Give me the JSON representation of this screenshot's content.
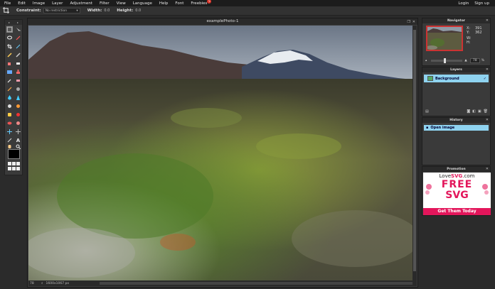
{
  "menu": {
    "items": [
      "File",
      "Edit",
      "Image",
      "Layer",
      "Adjustment",
      "Filter",
      "View",
      "Language",
      "Help",
      "Font",
      "Freebies"
    ],
    "freebies_badge": "5",
    "right": [
      "Login",
      "Sign up"
    ]
  },
  "options": {
    "constraint_label": "Constraint:",
    "constraint_value": "No restriction",
    "width_label": "Width:",
    "width_value": "0.0",
    "height_label": "Height:",
    "height_value": "0.0"
  },
  "canvas": {
    "title": "examplePhoto-1",
    "status_zoom": "78",
    "status_size": "1600x1067 px"
  },
  "navigator": {
    "title": "Navigator",
    "x_label": "X:",
    "x_value": "391",
    "y_label": "Y:",
    "y_value": "362",
    "w_label": "W:",
    "h_label": "H:",
    "zoom_value": "78",
    "zoom_unit": "%"
  },
  "layers": {
    "title": "Layers",
    "items": [
      {
        "label": "Background"
      }
    ]
  },
  "history": {
    "title": "History",
    "items": [
      {
        "label": "Open image"
      }
    ]
  },
  "promotion": {
    "title": "Promotion",
    "brand_prefix": "Love",
    "brand_mid": "SVG",
    "brand_suffix": ".com",
    "line1": "FREE",
    "line2": "SVG",
    "cta": "Get Them Today"
  },
  "colors": {
    "accent_selection": "#8fd3f0",
    "promo_pink": "#e3165b",
    "foreground": "#000000"
  }
}
